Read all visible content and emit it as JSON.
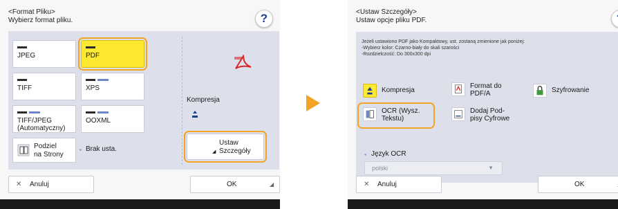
{
  "left": {
    "header_line1": "<Format Pliku>",
    "header_line2": "Wybierz format pliku.",
    "help_label": "?",
    "formats": {
      "jpeg": "JPEG",
      "pdf": "PDF",
      "tiff": "TIFF",
      "xps": "XPS",
      "tiffjpeg_line1": "TIFF/JPEG",
      "tiffjpeg_line2": "(Automatyczny)",
      "ooxml": "OOXML"
    },
    "selected_format": "PDF",
    "podziel_line1": "Podziel",
    "podziel_line2": "na Strony",
    "brak_label": "Brak usta.",
    "kompresja_label": "Kompresja",
    "ustaw_line1": "Ustaw",
    "ustaw_line2": "Szczegóły",
    "cancel_label": "Anuluj",
    "ok_label": "OK"
  },
  "right": {
    "header_line1": "<Ustaw Szczegóły>",
    "header_line2": "Ustaw opcje pliku PDF.",
    "help_label": "?",
    "info_line1": "Jeżeli ustawiono PDF jako Kompaktowy, ust. zostaną zmienione jak poniżej:",
    "info_line2": "-Wybierz kolor: Czarno-biały do skali szarości",
    "info_line3": "-Rozdzielczość: Do 300x300 dpi",
    "kompresja_label": "Kompresja",
    "format_pdfa_line1": "Format do",
    "format_pdfa_line2": "PDF/A",
    "szyfrowanie_label": "Szyfrowanie",
    "ocr_line1": "OCR (Wysz.",
    "ocr_line2": "Tekstu)",
    "podpisy_line1": "Dodaj Pod-",
    "podpisy_line2": "pisy Cyfrowe",
    "jezyk_label": "Język OCR",
    "jezyk_value": "polski",
    "cancel_label": "Anuluj",
    "ok_label": "OK"
  },
  "colors": {
    "selected_yellow": "#fde931",
    "highlight_orange": "#f2a422",
    "panel_bg": "#dde0ea",
    "help_blue": "#1c3f8c"
  }
}
